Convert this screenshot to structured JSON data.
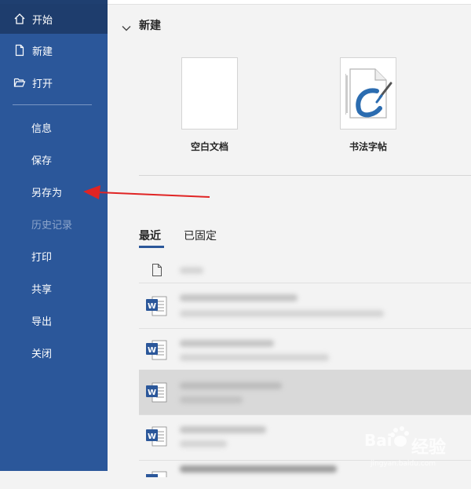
{
  "sidebar": {
    "items": [
      {
        "label": "开始",
        "icon": "home-icon"
      },
      {
        "label": "新建",
        "icon": "new-document-icon"
      },
      {
        "label": "打开",
        "icon": "open-folder-icon"
      },
      {
        "label": "信息"
      },
      {
        "label": "保存"
      },
      {
        "label": "另存为"
      },
      {
        "label": "历史记录"
      },
      {
        "label": "打印"
      },
      {
        "label": "共享"
      },
      {
        "label": "导出"
      },
      {
        "label": "关闭"
      }
    ]
  },
  "new_section": {
    "title": "新建",
    "templates": [
      {
        "label": "空白文档"
      },
      {
        "label": "书法字帖"
      }
    ]
  },
  "tabs": [
    {
      "label": "最近"
    },
    {
      "label": "已固定"
    }
  ],
  "watermark": {
    "text": "经验",
    "url": "jingyan.baidu.com"
  },
  "colors": {
    "sidebar": "#2b579a",
    "sidebar_active": "#1e3d6d",
    "arrow": "#e02424",
    "word_blue": "#2b579a"
  }
}
